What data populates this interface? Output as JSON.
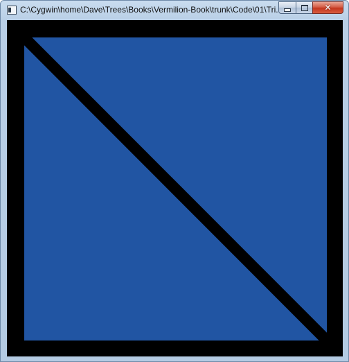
{
  "window": {
    "title": "C:\\Cygwin\\home\\Dave\\Trees\\Books\\Vermilion-Book\\trunk\\Code\\01\\Tri...",
    "icons": {
      "app": "console-window-icon",
      "minimize": "minimize-icon",
      "maximize": "maximize-icon",
      "close": "close-icon"
    }
  },
  "canvas": {
    "background_color": "#000000",
    "fill_color": "#2155a3",
    "line_color": "#000000"
  }
}
